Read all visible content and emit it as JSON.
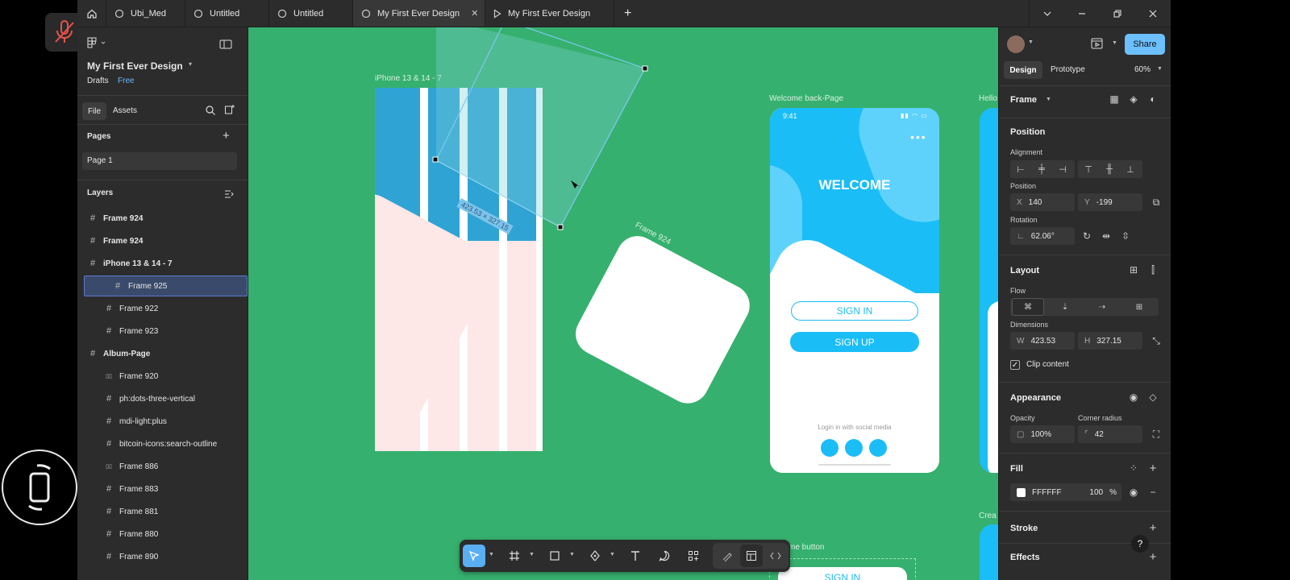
{
  "tabs": [
    {
      "label": "Ubi_Med"
    },
    {
      "label": "Untitled"
    },
    {
      "label": "Untitled"
    },
    {
      "label": "My First Ever Design",
      "close_label": "✕"
    },
    {
      "label": "My First Ever Design"
    }
  ],
  "new_tab_label": "+",
  "file": {
    "name": "My First Ever Design",
    "location": "Drafts",
    "plan": "Free"
  },
  "left_tabs": {
    "file": "File",
    "assets": "Assets"
  },
  "pages": {
    "title": "Pages",
    "items": [
      "Page 1"
    ]
  },
  "layers": {
    "title": "Layers",
    "items": [
      {
        "label": "Frame 924",
        "indent": 0,
        "icon": "frame-icon"
      },
      {
        "label": "Frame 924",
        "indent": 0,
        "icon": "frame-icon"
      },
      {
        "label": "iPhone 13 & 14 - 7",
        "indent": 0,
        "icon": "frame-icon"
      },
      {
        "label": "Frame 925",
        "indent": 1,
        "icon": "frame-icon",
        "selected": true
      },
      {
        "label": "Frame 922",
        "indent": 1,
        "icon": "frame-icon"
      },
      {
        "label": "Frame 923",
        "indent": 1,
        "icon": "frame-icon"
      },
      {
        "label": "Album-Page",
        "indent": 0,
        "icon": "frame-icon"
      },
      {
        "label": "Frame 920",
        "indent": 1,
        "icon": "auto-layout-icon"
      },
      {
        "label": "ph:dots-three-vertical",
        "indent": 1,
        "icon": "frame-icon"
      },
      {
        "label": "mdi-light:plus",
        "indent": 1,
        "icon": "frame-icon"
      },
      {
        "label": "bitcoin-icons:search-outline",
        "indent": 1,
        "icon": "frame-icon"
      },
      {
        "label": "Frame 886",
        "indent": 1,
        "icon": "auto-layout-icon"
      },
      {
        "label": "Frame 883",
        "indent": 1,
        "icon": "frame-icon"
      },
      {
        "label": "Frame 881",
        "indent": 1,
        "icon": "frame-icon"
      },
      {
        "label": "Frame 880",
        "indent": 1,
        "icon": "frame-icon"
      },
      {
        "label": "Frame 890",
        "indent": 1,
        "icon": "frame-icon"
      }
    ]
  },
  "canvas": {
    "bg_color": "#36b06e",
    "frame_labels": {
      "iphone": "iPhone 13 & 14 - 7",
      "welcome": "Welcome back-Page",
      "frame924": "Frame 924",
      "right_partial": "Hello",
      "bottom_partial": "me button",
      "create_partial": "Crea"
    },
    "dimension_badge": "423.53 × 327.15",
    "phone": {
      "time": "9:41",
      "title": "WELCOME",
      "sign_in": "SIGN IN",
      "sign_up": "SIGN UP",
      "social_text": "Login in with social media"
    },
    "bottom_button": "SIGN IN"
  },
  "right_panel": {
    "share_label": "Share",
    "tabs": {
      "design": "Design",
      "prototype": "Prototype"
    },
    "zoom": "60%",
    "frame_title": "Frame",
    "position": {
      "title": "Position",
      "alignment_label": "Alignment",
      "position_label": "Position",
      "x_label": "X",
      "x": "140",
      "y_label": "Y",
      "y": "-199",
      "rotation_label": "Rotation",
      "rotation": "62.06°"
    },
    "layout": {
      "title": "Layout",
      "flow_label": "Flow",
      "dimensions_label": "Dimensions",
      "w_label": "W",
      "w": "423.53",
      "h_label": "H",
      "h": "327.15",
      "clip_content": "Clip content"
    },
    "appearance": {
      "title": "Appearance",
      "opacity_label": "Opacity",
      "opacity": "100%",
      "radius_label": "Corner radius",
      "radius": "42"
    },
    "fill": {
      "title": "Fill",
      "hex": "FFFFFF",
      "opacity": "100",
      "percent": "%"
    },
    "stroke": {
      "title": "Stroke"
    },
    "effects": {
      "title": "Effects"
    },
    "help": "?"
  },
  "colors": {
    "accent": "#0d99ff",
    "share": "#6dc0ff",
    "phone_blue": "#1bbdf6"
  }
}
